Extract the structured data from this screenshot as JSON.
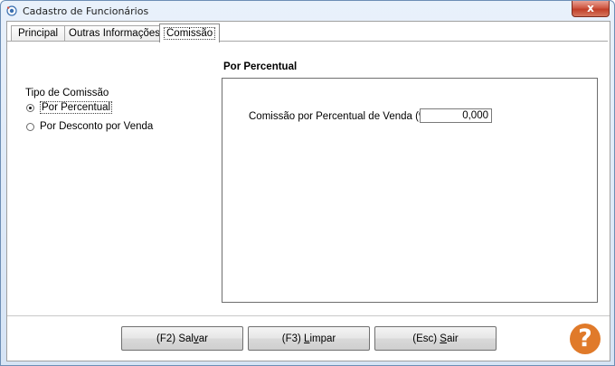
{
  "window": {
    "title": "Cadastro de Funcionários",
    "close_glyph": "x"
  },
  "tabs": [
    {
      "label": "Principal"
    },
    {
      "label": "Outras Informações"
    },
    {
      "label": "Comissão",
      "active": true
    }
  ],
  "commission": {
    "section_title": "Por Percentual",
    "group_label": "Tipo de Comissão",
    "options": [
      {
        "label": "Por Percentual",
        "checked": true
      },
      {
        "label": "Por Desconto por Venda",
        "checked": false
      }
    ],
    "field_label": "Comissão por Percentual de Venda (%):",
    "field_value": "0,000"
  },
  "buttons": {
    "save_prefix": "(F2) Sal",
    "save_mnemonic": "v",
    "save_suffix": "ar",
    "clear_prefix": "(F3) ",
    "clear_mnemonic": "L",
    "clear_suffix": "impar",
    "exit_prefix": "(Esc) ",
    "exit_mnemonic": "S",
    "exit_suffix": "air"
  },
  "help": {
    "glyph": "?"
  },
  "icons": {
    "app": "app-logo-icon",
    "close": "close-icon",
    "help": "help-icon"
  },
  "colors": {
    "help_accent": "#e07a2a",
    "close_button": "#c13f29"
  }
}
